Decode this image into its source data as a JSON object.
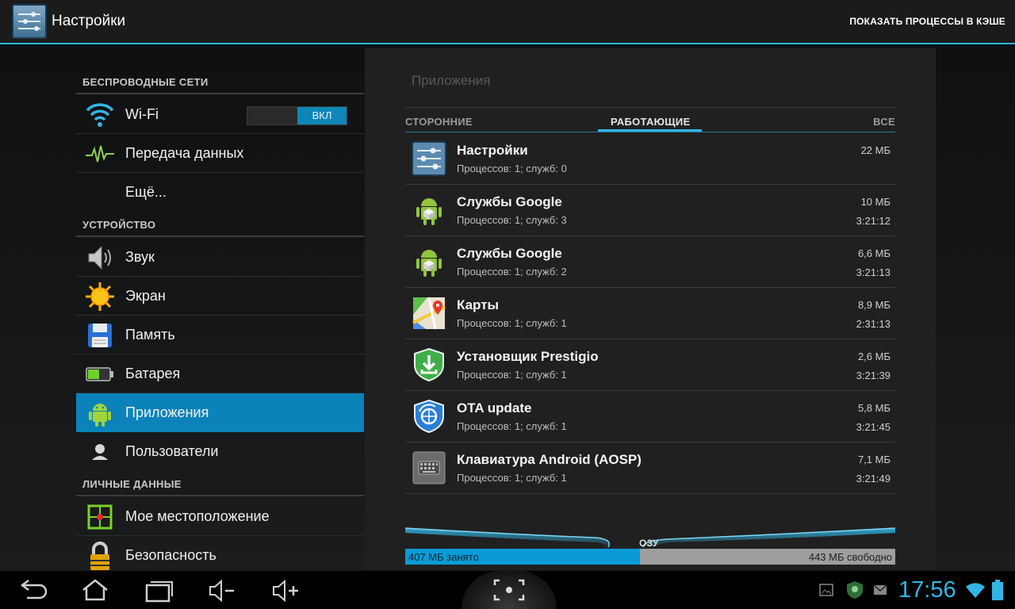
{
  "actionbar": {
    "title": "Настройки",
    "action": "ПОКАЗАТЬ ПРОЦЕССЫ В КЭШЕ"
  },
  "sidebar": {
    "categories": [
      "БЕСПРОВОДНЫЕ СЕТИ",
      "УСТРОЙСТВО",
      "ЛИЧНЫЕ ДАННЫЕ"
    ],
    "items": [
      {
        "label": "Wi-Fi",
        "icon": "wifi-icon"
      },
      {
        "label": "Передача данных",
        "icon": "data-usage-icon"
      },
      {
        "label": "Ещё...",
        "icon": ""
      },
      {
        "label": "Звук",
        "icon": "speaker-icon"
      },
      {
        "label": "Экран",
        "icon": "sun-icon"
      },
      {
        "label": "Память",
        "icon": "floppy-disk-icon"
      },
      {
        "label": "Батарея",
        "icon": "battery-icon"
      },
      {
        "label": "Приложения",
        "icon": "android-icon"
      },
      {
        "label": "Пользователи",
        "icon": "user-icon"
      },
      {
        "label": "Мое местоположение",
        "icon": "location-grid-icon"
      },
      {
        "label": "Безопасность",
        "icon": "padlock-icon"
      }
    ],
    "wifi_toggle": "ВКЛ",
    "active_color": "#0b83ba"
  },
  "panel": {
    "title": "Приложения",
    "tabs": [
      "СТОРОННИЕ",
      "РАБОТАЮЩИЕ",
      "ВСЕ"
    ],
    "selected_tab": "РАБОТАЮЩИЕ",
    "processes": [
      {
        "name": "Настройки",
        "desc": "Процессов: 1; служб: 0",
        "size": "22 МБ",
        "time": "",
        "icon": "settings-icon"
      },
      {
        "name": "Службы Google",
        "desc": "Процессов: 1; служб: 3",
        "size": "10 МБ",
        "time": "3:21:12",
        "icon": "android-package-icon"
      },
      {
        "name": "Службы Google",
        "desc": "Процессов: 1; служб: 2",
        "size": "6,6 МБ",
        "time": "3:21:13",
        "icon": "android-package-icon"
      },
      {
        "name": "Карты",
        "desc": "Процессов: 1; служб: 1",
        "size": "8,9 МБ",
        "time": "2:31:13",
        "icon": "maps-icon"
      },
      {
        "name": "Установщик Prestigio",
        "desc": "Процессов: 1; служб: 1",
        "size": "2,6 МБ",
        "time": "3:21:39",
        "icon": "installer-shield-icon"
      },
      {
        "name": "OTA update",
        "desc": "Процессов: 1; служб: 1",
        "size": "5,8 МБ",
        "time": "3:21:45",
        "icon": "ota-shield-icon"
      },
      {
        "name": "Клавиатура Android (AOSP)",
        "desc": "Процессов: 1; служб: 1",
        "size": "7,1 МБ",
        "time": "3:21:49",
        "icon": "keyboard-icon"
      }
    ],
    "ram": {
      "label": "ОЗУ",
      "used": "407 МБ занято",
      "free": "443 МБ свободно",
      "used_fraction": 0.479
    }
  },
  "sysbar": {
    "clock": "17:56",
    "accent": "#33b5e5"
  }
}
